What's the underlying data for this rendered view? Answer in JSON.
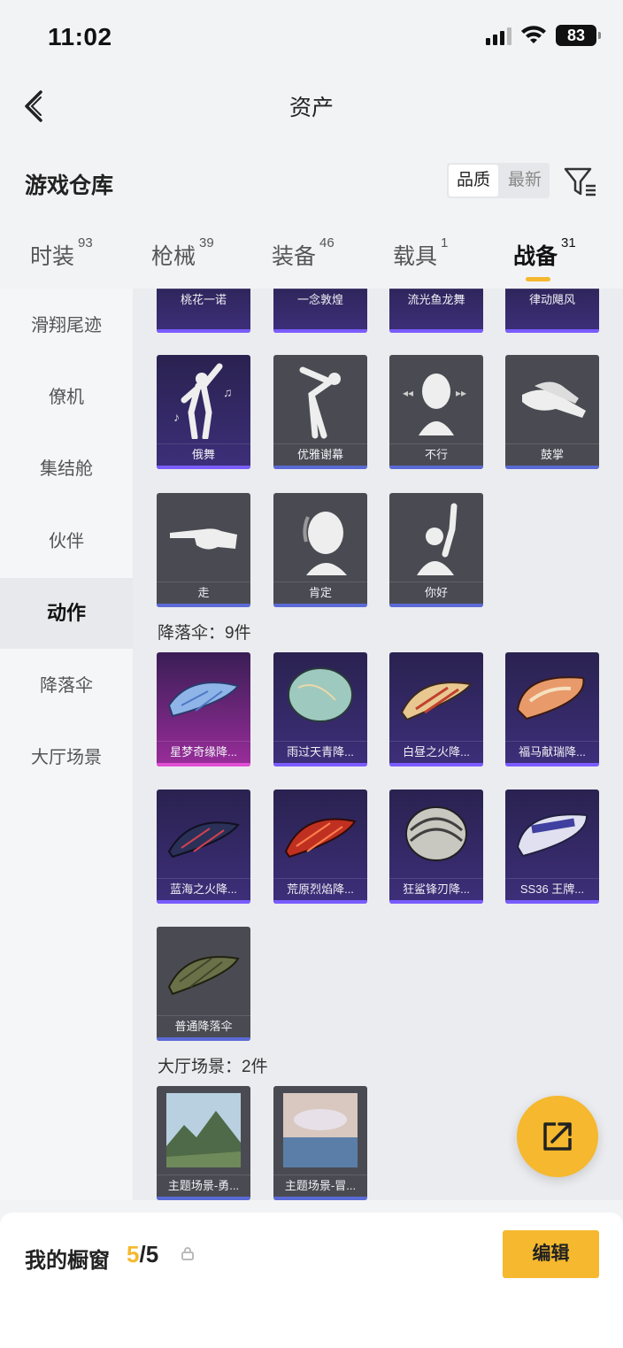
{
  "status_bar": {
    "time": "11:02",
    "battery": "83"
  },
  "nav": {
    "title": "资产"
  },
  "section": {
    "title": "游戏仓库",
    "sort_options": [
      "品质",
      "最新"
    ]
  },
  "tabs": [
    {
      "label": "时装",
      "count": "93"
    },
    {
      "label": "枪械",
      "count": "39"
    },
    {
      "label": "装备",
      "count": "46"
    },
    {
      "label": "载具",
      "count": "1"
    },
    {
      "label": "战备",
      "count": "31"
    }
  ],
  "sidebar": {
    "items": [
      "滑翔尾迹",
      "僚机",
      "集结舱",
      "伙伴",
      "动作",
      "降落伞",
      "大厅场景"
    ],
    "active": "动作"
  },
  "actions_row0": [
    "桃花一诺",
    "一念敦煌",
    "流光鱼龙舞",
    "律动飓风"
  ],
  "actions_row1": [
    "俄舞",
    "优雅谢幕",
    "不行",
    "鼓掌"
  ],
  "actions_row2": [
    "走",
    "肯定",
    "你好"
  ],
  "parachute_group": {
    "title": "降落伞：9件",
    "items": [
      "星梦奇缘降...",
      "雨过天青降...",
      "白昼之火降...",
      "福马献瑞降...",
      "蓝海之火降...",
      "荒原烈焰降...",
      "狂鲨锋刃降...",
      "SS36 王牌...",
      "普通降落伞"
    ]
  },
  "lobby_group": {
    "title": "大厅场景：2件",
    "items": [
      "主题场景-勇...",
      "主题场景-冒..."
    ]
  },
  "bottom": {
    "label": "我的橱窗",
    "current": "5",
    "total": "/5",
    "edit_label": "编辑"
  },
  "colors": {
    "accent": "#f5b82e",
    "rare_bar": "#5a6bd6",
    "epic_bar": "#7a5cff",
    "legend_bar": "#e04fd4"
  }
}
